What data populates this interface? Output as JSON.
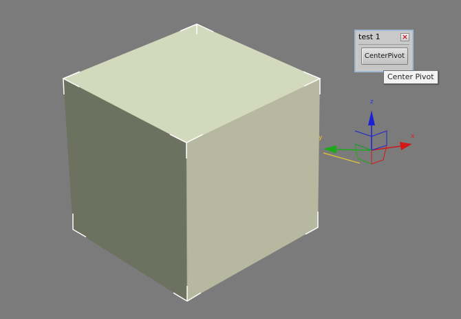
{
  "viewport": {
    "background": "#7b7b7b"
  },
  "cube": {
    "top_color": "#d3d9bc",
    "left_color": "#6d7160",
    "right_color": "#b6b99f",
    "selection_bracket_color": "#ffffff"
  },
  "gizmo": {
    "labels": {
      "x": "x",
      "y": "y",
      "z": "z"
    },
    "colors": {
      "x": "#d21818",
      "y": "#1ea81e",
      "z": "#1c22d2",
      "plane_x": "#d21818",
      "plane_y": "#1ea81e",
      "plane_z": "#1c22d2",
      "highlight": "#e8c830"
    }
  },
  "panel": {
    "title": "test 1",
    "close_glyph": "×",
    "button_label": "CenterPivot"
  },
  "tooltip": {
    "text": "Center Pivot"
  }
}
